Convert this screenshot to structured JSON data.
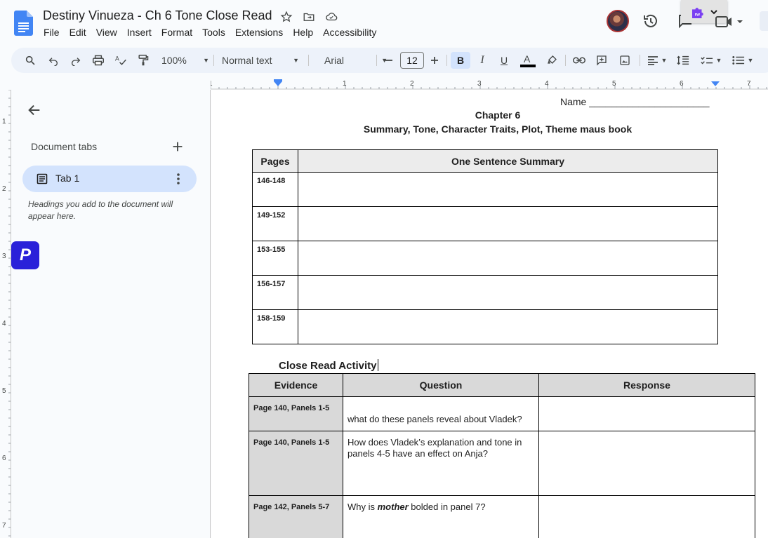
{
  "app": {
    "title": "Destiny Vinueza - Ch 6 Tone Close Read",
    "menu": [
      "File",
      "Edit",
      "View",
      "Insert",
      "Format",
      "Tools",
      "Extensions",
      "Help",
      "Accessibility"
    ]
  },
  "toolbar": {
    "zoom": "100%",
    "style": "Normal text",
    "font": "Arial",
    "font_size": "12",
    "bold": "B",
    "italic": "I",
    "underline": "U"
  },
  "ruler": {
    "labels": [
      "1",
      "1",
      "2",
      "3",
      "4",
      "5",
      "6",
      "7"
    ]
  },
  "vruler": {
    "labels": [
      "1",
      "2",
      "3",
      "4",
      "5",
      "6",
      "7"
    ]
  },
  "sidebar": {
    "heading": "Document tabs",
    "tab_label": "Tab 1",
    "hint": "Headings you add to the document will appear here.",
    "badge": "P"
  },
  "document": {
    "name_line": "Name ______________________",
    "chapter": "Chapter 6",
    "subtitle": "Summary, Tone, Character Traits, Plot, Theme maus book",
    "summary_table": {
      "headers": [
        "Pages",
        "One Sentence Summary"
      ],
      "rows": [
        "146-148",
        "149-152",
        "153-155",
        "156-157",
        "158-159"
      ]
    },
    "close_read_title": "Close Read Activity",
    "close_read_table": {
      "headers": [
        "Evidence",
        "Question",
        "Response"
      ],
      "rows": [
        {
          "evidence": "Page 140, Panels 1-5",
          "question": "what do these panels reveal about Vladek?"
        },
        {
          "evidence": "Page 140, Panels 1-5",
          "question": "How does Vladek’s explanation and tone in panels 4-5 have an effect on Anja?"
        },
        {
          "evidence": "Page 142, Panels 5-7",
          "question_pre": "Why is ",
          "question_em": "mother",
          "question_post": " bolded in panel 7?"
        }
      ]
    }
  },
  "colors": {
    "accent": "#0b57d0",
    "docs_blue": "#4285f4",
    "selected": "#d3e3fd",
    "badge": "#2a21d9"
  }
}
